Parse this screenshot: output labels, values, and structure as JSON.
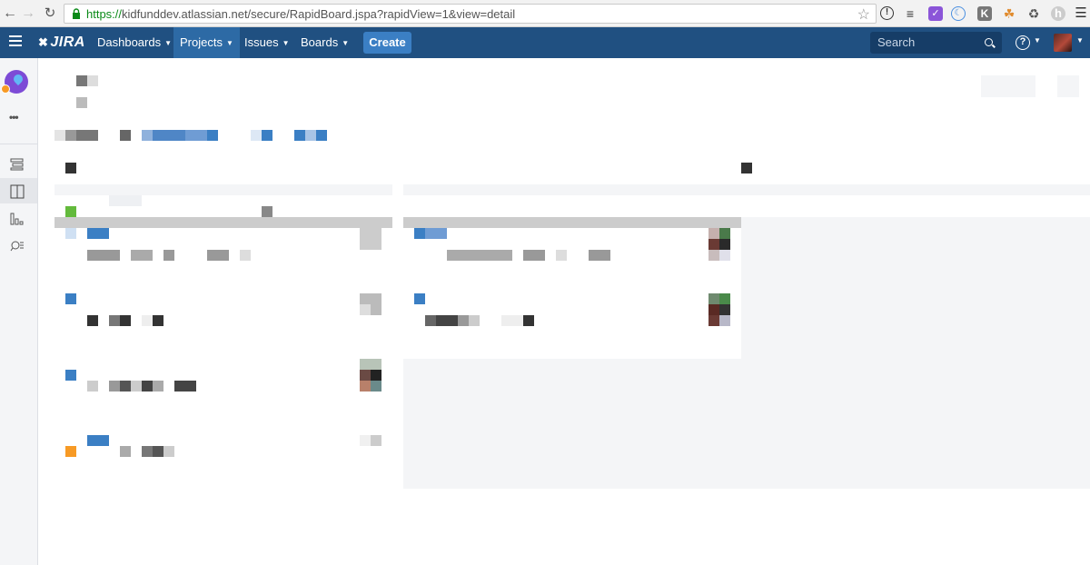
{
  "browser": {
    "url_scheme": "https://",
    "url_rest": "kidfunddev.atlassian.net/secure/RapidBoard.jspa?rapidView=1&view=detail",
    "extensions": [
      "info-icon",
      "buffer-icon",
      "checkbox-ext-icon",
      "moon-ext-icon",
      "k-ext-icon",
      "bird-ext-icon",
      "recycle-icon",
      "h-ext-icon",
      "menu-icon"
    ]
  },
  "header": {
    "nav": {
      "dashboards": "Dashboards",
      "projects": "Projects",
      "issues": "Issues",
      "boards": "Boards"
    },
    "create_label": "Create",
    "search_placeholder": "Search",
    "help_glyph": "?"
  },
  "sidebar": {
    "icons": [
      "backlog-icon",
      "board-icon",
      "reports-icon",
      "issue-search-icon"
    ],
    "active": "board-icon"
  },
  "colors": {
    "header": "#205081",
    "accent": "#3b7fc4",
    "story": "#63ba3c",
    "bug": "#f79a25"
  }
}
